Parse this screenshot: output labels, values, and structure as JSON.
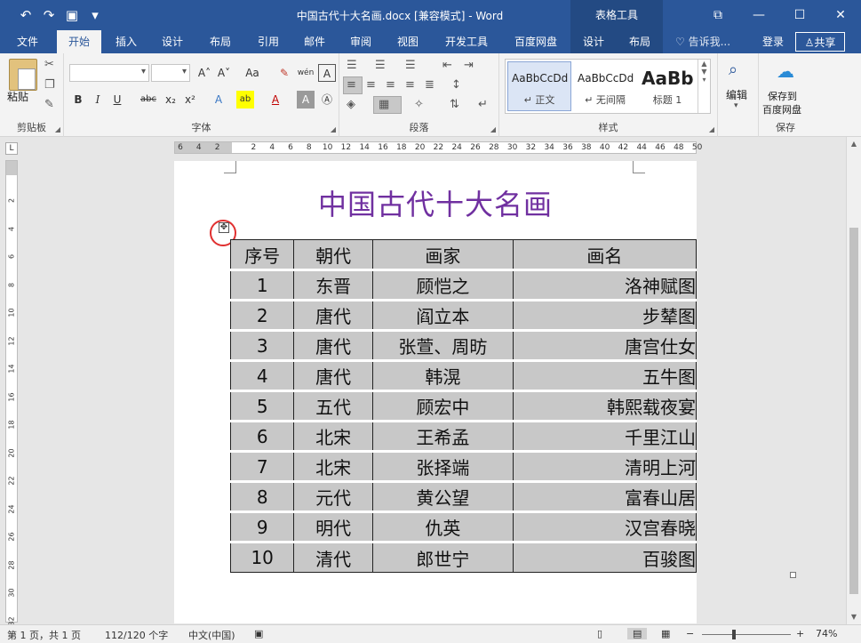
{
  "titlebar": {
    "doc_title": "中国古代十大名画.docx [兼容模式] - Word",
    "context_tools": "表格工具",
    "qat": {
      "undo_icon": "↶",
      "redo_icon": "↷",
      "save_icon": "▣",
      "customize_icon": "▾"
    },
    "win": {
      "restore": "⧉",
      "minimize": "—",
      "maximize": "☐",
      "close": "✕"
    }
  },
  "tabs": {
    "file": "文件",
    "home": "开始",
    "insert": "插入",
    "design": "设计",
    "layout": "布局",
    "references": "引用",
    "mailings": "邮件",
    "review": "审阅",
    "view": "视图",
    "developer": "开发工具",
    "baidu": "百度网盘",
    "table_design": "设计",
    "table_layout": "布局",
    "tell_me": "告诉我...",
    "login": "登录",
    "share": "共享"
  },
  "ribbon": {
    "clipboard": {
      "paste": "粘贴",
      "label": "剪贴板"
    },
    "font": {
      "label": "字体",
      "bold": "B",
      "italic": "I",
      "underline": "U",
      "strike": "abc",
      "subscript": "x₂",
      "superscript": "x²",
      "grow": "A˄",
      "shrink": "A˅",
      "case": "Aa",
      "clear": "✎",
      "phonetic": "wén",
      "border_char": "A",
      "effects": "A",
      "highlight": "ab",
      "color": "A",
      "shade": "A",
      "circle": "Ⓐ"
    },
    "paragraph": {
      "label": "段落"
    },
    "styles": {
      "label": "样式",
      "items": [
        {
          "sample": "AaBbCcDd",
          "name": "↵ 正文"
        },
        {
          "sample": "AaBbCcDd",
          "name": "↵ 无间隔"
        },
        {
          "sample": "AaBb",
          "name": "标题 1"
        }
      ]
    },
    "editing": {
      "label": "编辑"
    },
    "save": {
      "line1": "保存到",
      "line2": "百度网盘",
      "label": "保存"
    }
  },
  "ruler": {
    "corner": "L",
    "ticks": [
      "6",
      "4",
      "2",
      "2",
      "4",
      "6",
      "8",
      "10",
      "12",
      "14",
      "16",
      "18",
      "20",
      "22",
      "24",
      "26",
      "28",
      "30",
      "32",
      "34",
      "36",
      "38",
      "40",
      "42",
      "44",
      "46",
      "48",
      "50"
    ],
    "vticks": [
      "2",
      "4",
      "6",
      "8",
      "10",
      "12",
      "14",
      "16",
      "18",
      "20",
      "22",
      "24",
      "26",
      "28",
      "30",
      "32"
    ]
  },
  "document": {
    "heading": "中国古代十大名画",
    "table_handle": "✥",
    "table": {
      "headers": [
        "序号",
        "朝代",
        "画家",
        "画名"
      ],
      "rows": [
        [
          "1",
          "东晋",
          "顾恺之",
          "洛神赋图"
        ],
        [
          "2",
          "唐代",
          "阎立本",
          "步辇图"
        ],
        [
          "3",
          "唐代",
          "张萱、周昉",
          "唐宫仕女"
        ],
        [
          "4",
          "唐代",
          "韩滉",
          "五牛图"
        ],
        [
          "5",
          "五代",
          "顾宏中",
          "韩熙载夜宴"
        ],
        [
          "6",
          "北宋",
          "王希孟",
          "千里江山"
        ],
        [
          "7",
          "北宋",
          "张择端",
          "清明上河"
        ],
        [
          "8",
          "元代",
          "黄公望",
          "富春山居"
        ],
        [
          "9",
          "明代",
          "仇英",
          "汉宫春晓"
        ],
        [
          "10",
          "清代",
          "郎世宁",
          "百骏图"
        ]
      ]
    }
  },
  "statusbar": {
    "page": "第 1 页，共 1 页",
    "words": "112/120 个字",
    "lang": "中文(中国)",
    "zoom_minus": "−",
    "zoom_plus": "+",
    "zoom": "74%"
  }
}
